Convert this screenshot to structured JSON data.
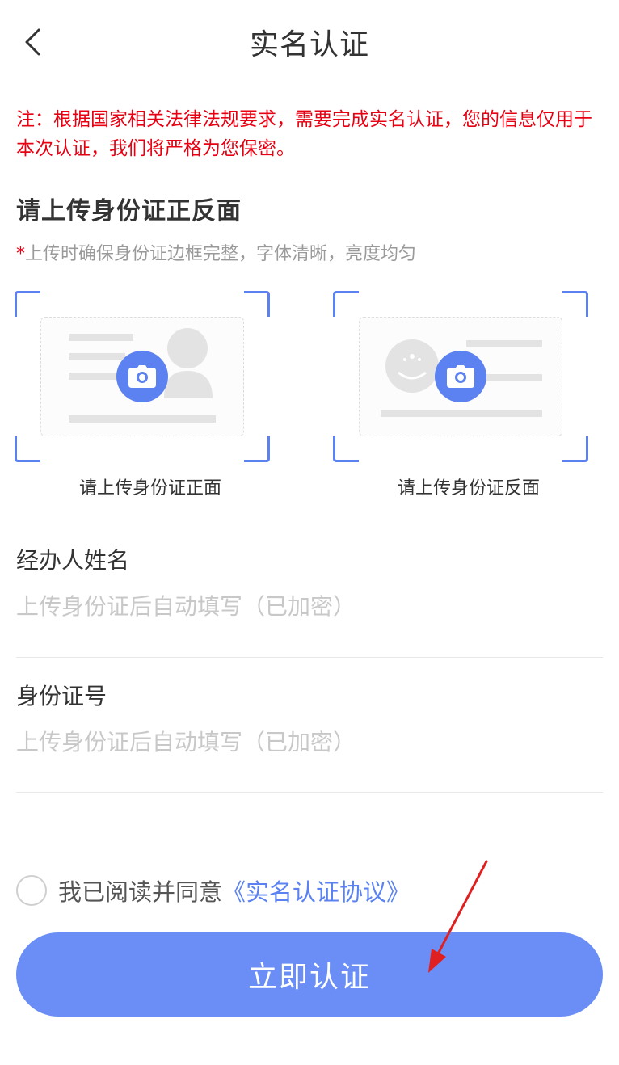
{
  "header": {
    "back_icon": "chevron-left-icon",
    "title": "实名认证"
  },
  "notice": {
    "text": "注：根据国家相关法律法规要求，需要完成实名认证，您的信息仅用于本次认证，我们将严格为您保密。",
    "color": "#e60012"
  },
  "upload": {
    "title": "请上传身份证正反面",
    "hint_star": "*",
    "hint": "上传时确保身份证边框完整，字体清晰，亮度均匀",
    "front": {
      "caption": "请上传身份证正面",
      "icon": "camera-icon"
    },
    "back": {
      "caption": "请上传身份证反面",
      "icon": "camera-icon"
    }
  },
  "form": {
    "name": {
      "label": "经办人姓名",
      "value": "",
      "placeholder": "上传身份证后自动填写（已加密）"
    },
    "id_number": {
      "label": "身份证号",
      "value": "",
      "placeholder": "上传身份证后自动填写（已加密）"
    }
  },
  "agreement": {
    "text": "我已阅读并同意",
    "link": "《实名认证协议》",
    "checked": false
  },
  "submit": {
    "label": "立即认证"
  },
  "colors": {
    "accent": "#5b82f0",
    "button": "#6a8ef5",
    "warning": "#e60012",
    "annotation_arrow": "#e02020"
  }
}
